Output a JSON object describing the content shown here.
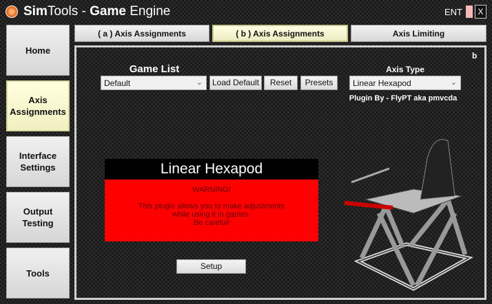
{
  "app": {
    "title_bold": "Sim",
    "title_rest": "Tools - ",
    "title_bold2": "Game",
    "title_rest2": " Engine",
    "ent_label": "ENT",
    "close_label": "X"
  },
  "sidebar": {
    "items": [
      {
        "label": "Home"
      },
      {
        "label": "Axis Assignments"
      },
      {
        "label": "Interface Settings"
      },
      {
        "label": "Output Testing"
      },
      {
        "label": "Tools"
      }
    ]
  },
  "tabs": [
    {
      "label": "( a ) Axis Assignments"
    },
    {
      "label": "( b ) Axis Assignments"
    },
    {
      "label": "Axis Limiting"
    }
  ],
  "panel": {
    "corner_label": "b",
    "game_list_label": "Game List",
    "game_list_value": "Default",
    "load_default": "Load Default",
    "reset": "Reset",
    "presets": "Presets",
    "axis_type_label": "Axis Type",
    "axis_type_value": "Linear Hexapod",
    "plugin_by": "Plugin By - FlyPT aka pmvcda"
  },
  "warning": {
    "title": "Linear Hexapod",
    "heading": "WARNING!",
    "line1": "This plugin allows you to make adjustments",
    "line2": "while using it in games.",
    "line3": "Be careful!"
  },
  "setup_label": "Setup"
}
